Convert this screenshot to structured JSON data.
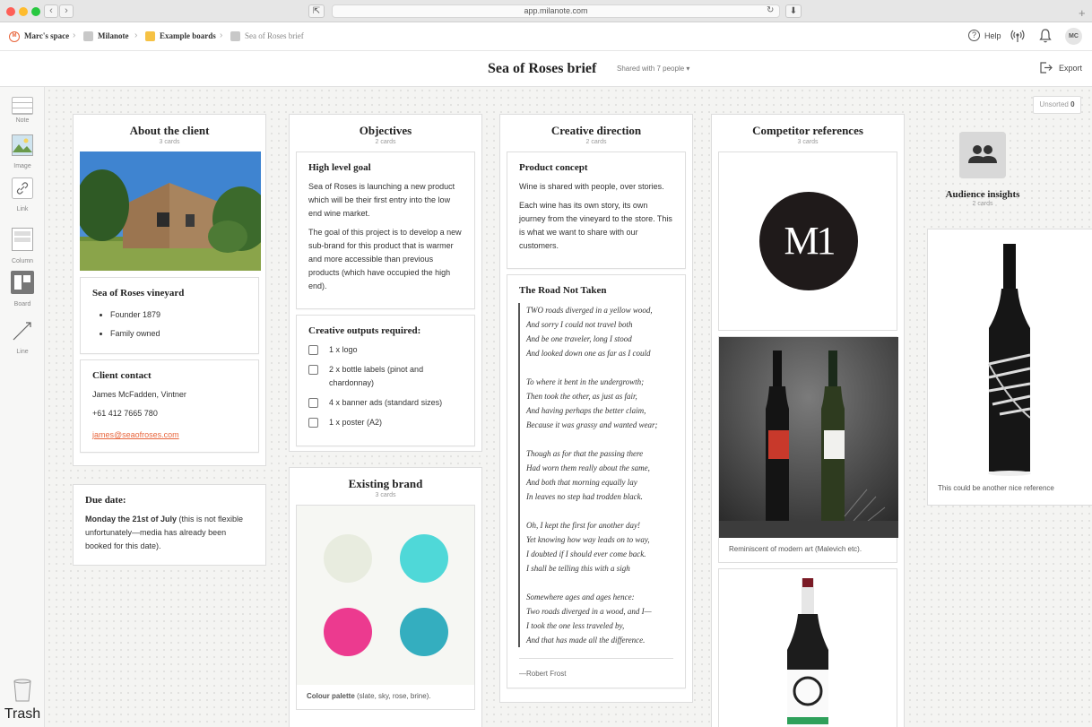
{
  "browser": {
    "url": "app.milanote.com",
    "back_glyph": "‹",
    "forward_glyph": "›",
    "sidebar_glyph": "⇱",
    "reload_glyph": "↻",
    "download_glyph": "⬇",
    "new_tab_glyph": "+"
  },
  "header": {
    "logo_text": "M",
    "breadcrumbs": [
      "Marc's space",
      "Milanote",
      "Example boards",
      "Sea of Roses brief"
    ],
    "crumb_sep": "›",
    "help_label": "Help",
    "help_glyph": "?",
    "avatar_initials": "MC"
  },
  "board": {
    "title": "Sea of Roses brief",
    "shared": "Shared with 7 people ▾",
    "export_label": "Export",
    "unsorted_label": "Unsorted",
    "unsorted_count": "0"
  },
  "toolbar": {
    "note": "Note",
    "image": "Image",
    "link": "Link",
    "column": "Column",
    "board": "Board",
    "line": "Line",
    "trash": "Trash"
  },
  "columns": {
    "client": {
      "title": "About the client",
      "count": "3 cards",
      "vineyard_title": "Sea of Roses vineyard",
      "vineyard_items": [
        "Founder 1879",
        "Family owned"
      ],
      "contact_title": "Client contact",
      "contact_name": "James McFadden, Vintner",
      "contact_phone": "+61 412 7665 780",
      "contact_email": "james@seaofroses.com"
    },
    "objectives": {
      "title": "Objectives",
      "count": "2 cards",
      "goal_title": "High level goal",
      "goal_p1": "Sea of Roses is launching a new product which will be their first entry into the low end wine market.",
      "goal_p2": "The goal of this project is to develop a new sub-brand for this product that is warmer and more accessible than previous products (which have occupied the high end).",
      "outputs_title": "Creative outputs required:",
      "outputs": [
        "1 x logo",
        "2 x bottle labels (pinot and chardonnay)",
        "4 x banner ads (standard sizes)",
        "1 x poster (A2)"
      ]
    },
    "brand": {
      "title": "Existing brand",
      "count": "3 cards",
      "palette_caption_bold": "Colour palette",
      "palette_caption_rest": " (slate, sky, rose, brine).",
      "palette": [
        "#e8ecdf",
        "#4fd8d8",
        "#ec3a8f",
        "#34aebf"
      ]
    },
    "creative": {
      "title": "Creative direction",
      "count": "2 cards",
      "concept_title": "Product concept",
      "concept_p1": "Wine is shared with people, over stories.",
      "concept_p2": "Each wine has its own story, its own journey from the vineyard to the store. This is what we want to share with our customers.",
      "poem_title": "The Road Not Taken",
      "stanzas": [
        [
          "TWO roads diverged in a yellow wood,",
          "And sorry I could not travel both",
          "And be one traveler, long I stood",
          "And looked down one as far as I could"
        ],
        [
          "To where it bent in the undergrowth;",
          "Then took the other, as just as fair,",
          "And having perhaps the better claim,",
          "Because it was grassy and wanted wear;"
        ],
        [
          "Though as for that the passing there",
          "Had worn them really about the same,",
          "And both that morning equally lay",
          "In leaves no step had trodden black."
        ],
        [
          "Oh, I kept the first for another day!",
          "Yet knowing how way leads on to way,",
          "I doubted if I should ever come back.",
          "I shall be telling this with a sigh"
        ],
        [
          "Somewhere ages and ages hence:",
          "Two roads diverged in a wood, and I—",
          "I took the one less traveled by,",
          "And that has made all the difference."
        ]
      ],
      "poem_author": "—Robert Frost"
    },
    "competitor": {
      "title": "Competitor references",
      "count": "3 cards",
      "logo_text": "M1",
      "caption": "Reminiscent of modern art (Malevich etc)."
    }
  },
  "audience": {
    "title": "Audience insights",
    "count": "2 cards"
  },
  "reference_caption": "This could be another nice reference",
  "due": {
    "title": "Due date:",
    "bold": "Monday the 21st of July",
    "rest": " (this is not flexible unfortunately—media has already been booked for this date)."
  },
  "colors": {
    "accent": "#e8663d",
    "board_yellow": "#f6c244",
    "grey_square": "#c8c8c8"
  }
}
